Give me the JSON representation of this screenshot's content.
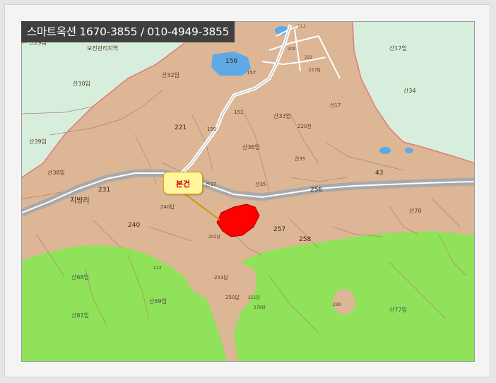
{
  "banner": {
    "text": "스마트옥션 1670-3855 / 010-4949-3855"
  },
  "callout": {
    "text": "본건",
    "color": "#d10000"
  },
  "colors": {
    "land": "#dcb695",
    "forest": "#8fe25a",
    "greenbelt": "#d7eedd",
    "road": "#a9a9a9",
    "water": "#5ea9e6",
    "subject": "#ff0000"
  },
  "labels": {
    "village": "지방리",
    "zone": "보전관리지역",
    "parcels": {
      "p156": "156",
      "p221": "221",
      "p231": "231",
      "p240": "240",
      "p256": "256",
      "p257": "257",
      "p258": "258",
      "p43": "43",
      "p1572": "157",
      "p150": "150",
      "p151": "151",
      "p240d": "240답",
      "p250": "250답",
      "p251": "251답",
      "p253": "253답",
      "p252": "252답",
      "p279": "279답",
      "p222": "222",
      "p217": "217답",
      "p200": "200",
      "p183": "183",
      "p220": "220전",
      "p239": "239",
      "p213": "213"
    },
    "mountain": {
      "s17": "산17임",
      "s29": "산29임",
      "s30": "산30임",
      "s32": "산32임",
      "s33": "산33임",
      "s34": "산34",
      "s36": "산36임",
      "s37": "산37",
      "s39": "산39임",
      "s38": "산38임",
      "s35": "산35",
      "s352": "산35",
      "s68": "산68임",
      "s69": "산69임",
      "s81": "산81임",
      "s77": "산77임",
      "s70": "산70",
      "s17b": "산17"
    }
  }
}
